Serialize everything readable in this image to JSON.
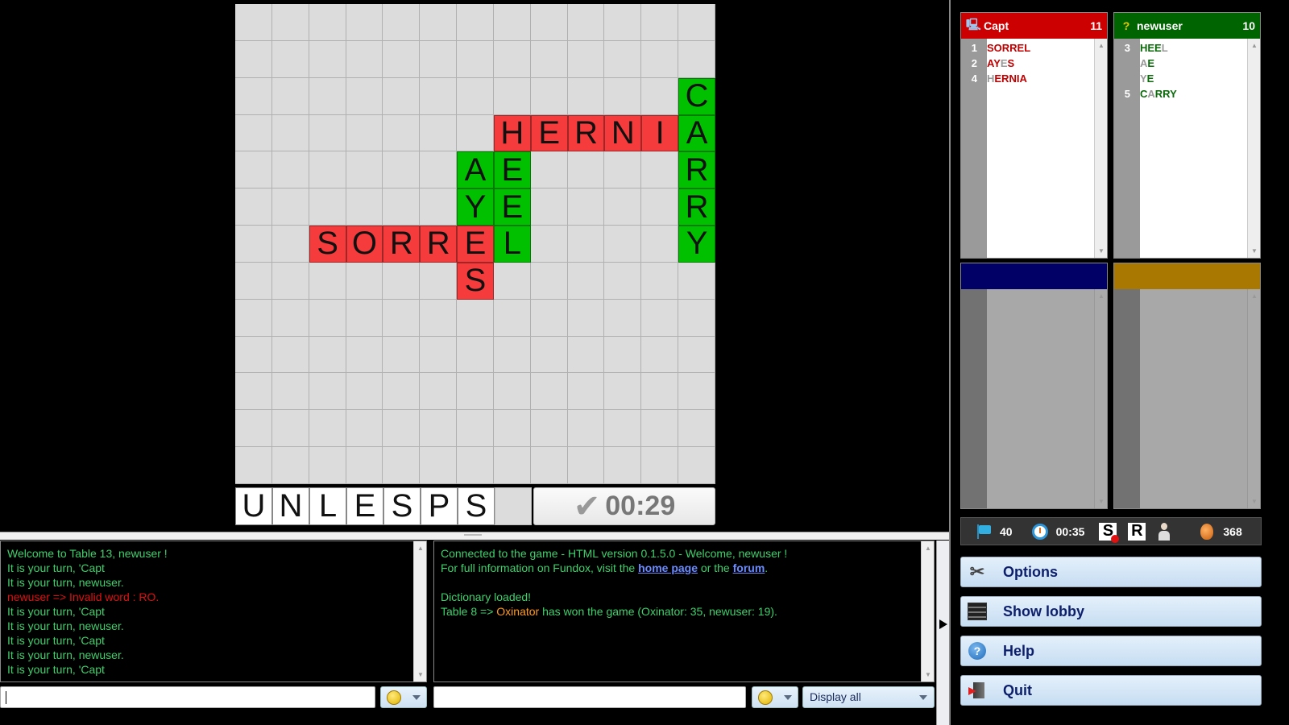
{
  "board": {
    "size": 13,
    "tiles": [
      {
        "row": 2,
        "col": 12,
        "letter": "C",
        "color": "green"
      },
      {
        "row": 3,
        "col": 7,
        "letter": "H",
        "color": "red"
      },
      {
        "row": 3,
        "col": 8,
        "letter": "E",
        "color": "red"
      },
      {
        "row": 3,
        "col": 9,
        "letter": "R",
        "color": "red"
      },
      {
        "row": 3,
        "col": 10,
        "letter": "N",
        "color": "red"
      },
      {
        "row": 3,
        "col": 11,
        "letter": "I",
        "color": "red"
      },
      {
        "row": 3,
        "col": 12,
        "letter": "A",
        "color": "green"
      },
      {
        "row": 4,
        "col": 6,
        "letter": "A",
        "color": "green"
      },
      {
        "row": 4,
        "col": 7,
        "letter": "E",
        "color": "green"
      },
      {
        "row": 4,
        "col": 12,
        "letter": "R",
        "color": "green"
      },
      {
        "row": 5,
        "col": 6,
        "letter": "Y",
        "color": "green"
      },
      {
        "row": 5,
        "col": 7,
        "letter": "E",
        "color": "green"
      },
      {
        "row": 5,
        "col": 12,
        "letter": "R",
        "color": "green"
      },
      {
        "row": 6,
        "col": 2,
        "letter": "S",
        "color": "red"
      },
      {
        "row": 6,
        "col": 3,
        "letter": "O",
        "color": "red"
      },
      {
        "row": 6,
        "col": 4,
        "letter": "R",
        "color": "red"
      },
      {
        "row": 6,
        "col": 5,
        "letter": "R",
        "color": "red"
      },
      {
        "row": 6,
        "col": 6,
        "letter": "E",
        "color": "red"
      },
      {
        "row": 6,
        "col": 7,
        "letter": "L",
        "color": "green"
      },
      {
        "row": 6,
        "col": 12,
        "letter": "Y",
        "color": "green"
      },
      {
        "row": 7,
        "col": 6,
        "letter": "S",
        "color": "red"
      }
    ]
  },
  "rack": {
    "letters": [
      "U",
      "N",
      "L",
      "E",
      "S",
      "P",
      "S"
    ],
    "empty_slots": 1,
    "timer": "00:29",
    "submit_icon": "checkmark-icon"
  },
  "chat_left": {
    "lines": [
      {
        "text": "Welcome to Table 13, newuser !",
        "style": "normal"
      },
      {
        "text": "It is your turn, 'Capt",
        "style": "normal"
      },
      {
        "text": "It is your turn, newuser.",
        "style": "normal"
      },
      {
        "text": "newuser => Invalid word : RO.",
        "style": "red"
      },
      {
        "text": "It is your turn, 'Capt",
        "style": "normal"
      },
      {
        "text": "It is your turn, newuser.",
        "style": "normal"
      },
      {
        "text": "It is your turn, 'Capt",
        "style": "normal"
      },
      {
        "text": "It is your turn, newuser.",
        "style": "normal"
      },
      {
        "text": "It is your turn, 'Capt",
        "style": "normal"
      }
    ],
    "input_value": ""
  },
  "chat_right": {
    "line1": "Connected to the game - HTML version 0.1.5.0 - Welcome, newuser !",
    "line2_pre": "For full information on Fundox, visit the ",
    "link_home": "home page",
    "line2_mid": " or the ",
    "link_forum": "forum",
    "line2_post": ".",
    "line3": "Dictionary loaded!",
    "line4_pre": "Table 8 => ",
    "line4_name": "Oxinator",
    "line4_post": " has won the game (Oxinator: 35, newuser: 19).",
    "input_value": "",
    "filter_selected": "Display all"
  },
  "players": [
    {
      "name": "Capt",
      "score": "11",
      "header_color": "#cc0000",
      "icon": "computer-icon",
      "icon_glyph": "🖳",
      "words": [
        {
          "num": "1",
          "parts": [
            {
              "t": "SORREL",
              "dim": false
            }
          ]
        },
        {
          "num": "2",
          "parts": [
            {
              "t": "AY",
              "dim": false
            },
            {
              "t": "E",
              "dim": true
            },
            {
              "t": "S",
              "dim": false
            }
          ]
        },
        {
          "num": "4",
          "parts": [
            {
              "t": "H",
              "dim": true
            },
            {
              "t": "ERNIA",
              "dim": false
            }
          ]
        }
      ]
    },
    {
      "name": "newuser",
      "score": "10",
      "header_color": "#006400",
      "icon": "question-icon",
      "icon_glyph": "?",
      "words": [
        {
          "num": "3",
          "parts": [
            {
              "t": "HEE",
              "dim": false
            },
            {
              "t": "L",
              "dim": true
            }
          ]
        },
        {
          "num": "",
          "parts": [
            {
              "t": " A",
              "dim": true
            },
            {
              "t": "E",
              "dim": false
            }
          ]
        },
        {
          "num": "",
          "parts": [
            {
              "t": " Y",
              "dim": true
            },
            {
              "t": "E",
              "dim": false
            }
          ]
        },
        {
          "num": "5",
          "parts": [
            {
              "t": "C",
              "dim": false
            },
            {
              "t": "A",
              "dim": true
            },
            {
              "t": "RRY",
              "dim": false
            }
          ]
        }
      ]
    },
    {
      "name": "",
      "score": "",
      "header_color": "#000066",
      "words": []
    },
    {
      "name": "",
      "score": "",
      "header_color": "#a87800",
      "words": []
    }
  ],
  "status": {
    "tiles_left": "40",
    "time": "00:35",
    "swap_label": "S",
    "resign_label": "R",
    "bag_count": "368"
  },
  "menu": [
    {
      "label": "Options",
      "icon": "tools-icon"
    },
    {
      "label": "Show lobby",
      "icon": "lobby-icon"
    },
    {
      "label": "Help",
      "icon": "help-icon"
    },
    {
      "label": "Quit",
      "icon": "quit-icon"
    }
  ]
}
